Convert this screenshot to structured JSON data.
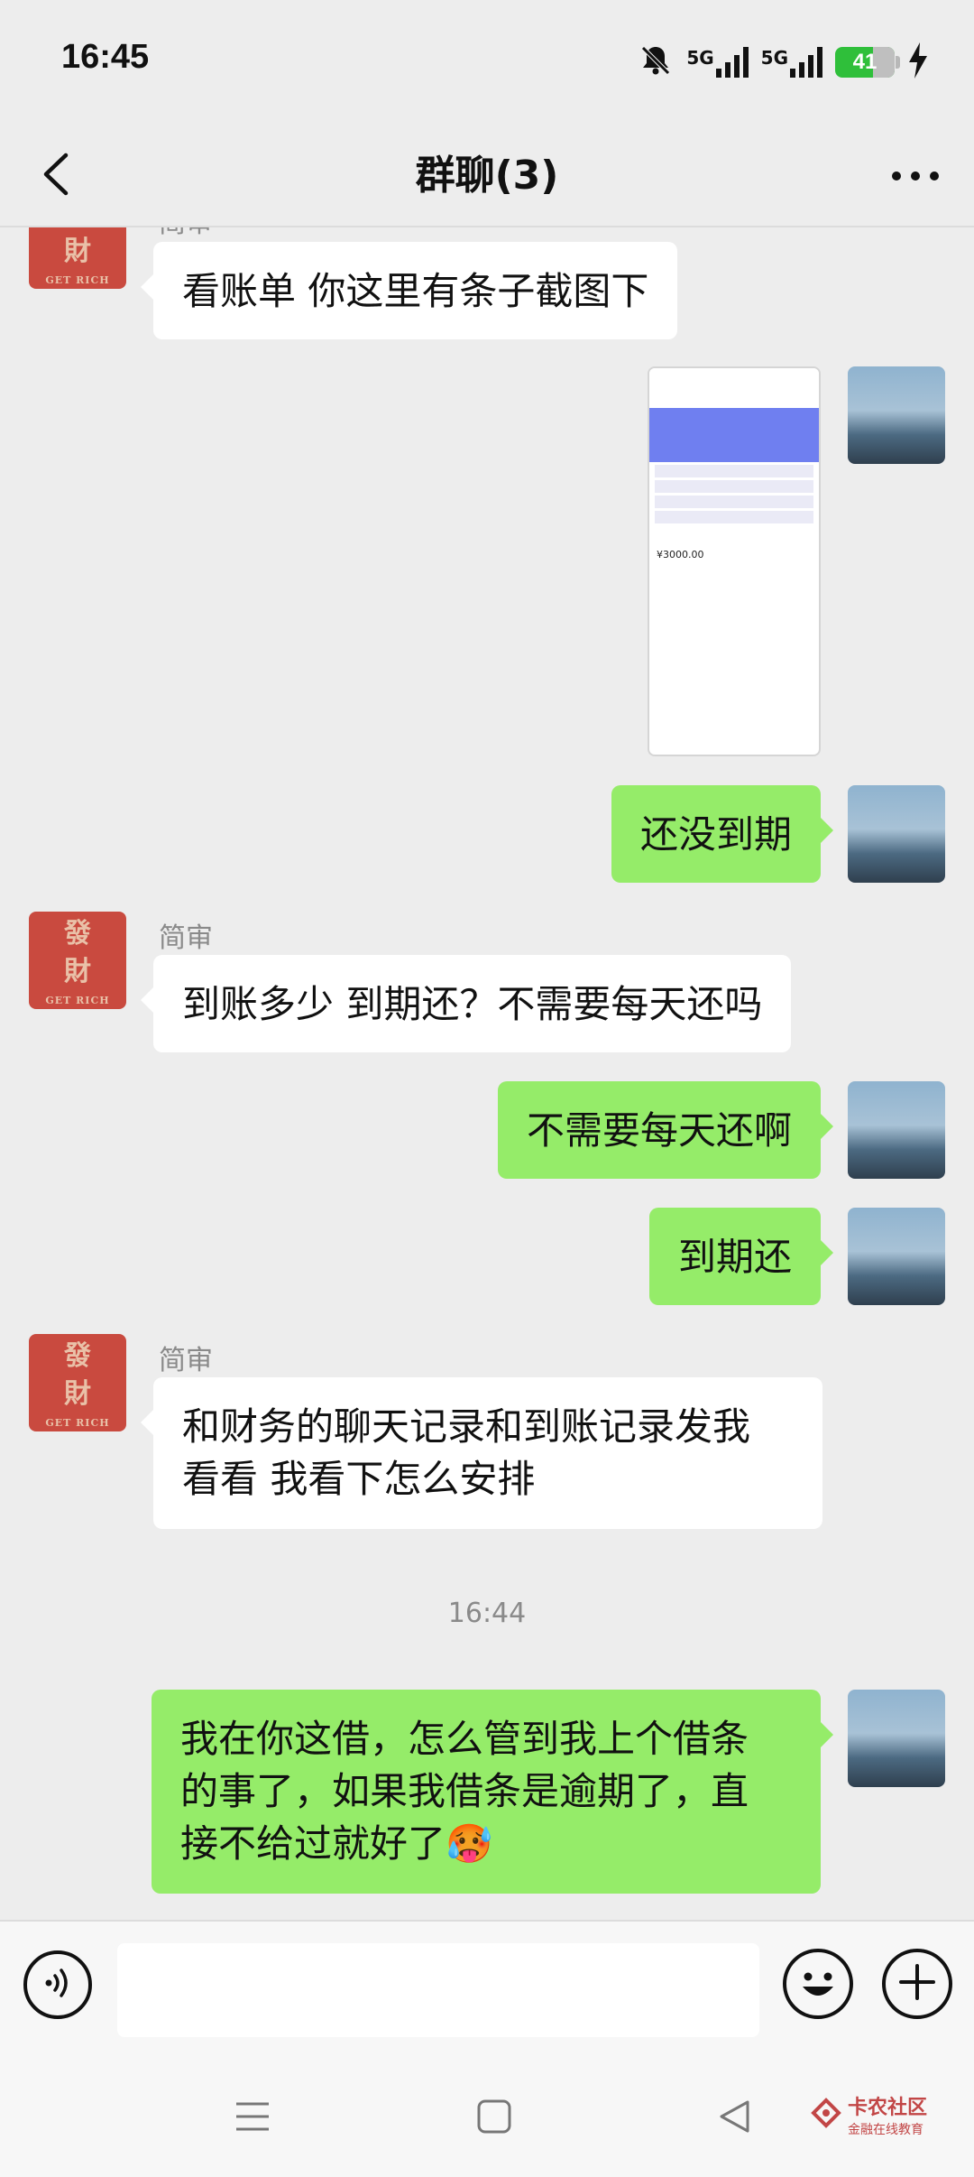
{
  "status_bar": {
    "time": "16:45",
    "network1": "5G",
    "network2": "5G",
    "battery": "41"
  },
  "nav": {
    "title": "群聊(3)"
  },
  "colors": {
    "background": "#ededed",
    "bubble_sent": "#95ec69",
    "bubble_received": "#ffffff",
    "battery": "#2fbf3a"
  },
  "messages": {
    "m1": {
      "sender": "简审",
      "text": "看账单  你这里有条子截图下"
    },
    "m2": {
      "type": "image",
      "amount": "¥3000.00"
    },
    "m3": {
      "text": "还没到期"
    },
    "m4": {
      "sender": "简审",
      "text": "到账多少 到期还？不需要每天还吗"
    },
    "m5": {
      "text": "不需要每天还啊"
    },
    "m6": {
      "text": "到期还"
    },
    "m7": {
      "sender": "简审",
      "text_line1": "和财务的聊天记录和到账记录发我",
      "text_line2": "看看 我看下怎么安排"
    },
    "time_divider": "16:44",
    "m8": {
      "text_line1": "我在你这借，怎么管到我上个借条",
      "text_line2": "的事了，如果我借条是逾期了，直",
      "text_line3": "接不给过就好了",
      "emoji": "🥵"
    }
  },
  "avatar_left": {
    "char1": "發",
    "char2": "財",
    "caption": "GET RICH"
  },
  "watermark": {
    "title": "卡农社区",
    "subtitle": "金融在线教育"
  },
  "icons": {
    "back": "chevron-left-icon",
    "more": "more-dots-icon",
    "voice": "voice-icon",
    "emoji": "emoji-icon",
    "plus": "plus-icon",
    "mute": "bell-off-icon",
    "charging": "bolt-icon"
  }
}
